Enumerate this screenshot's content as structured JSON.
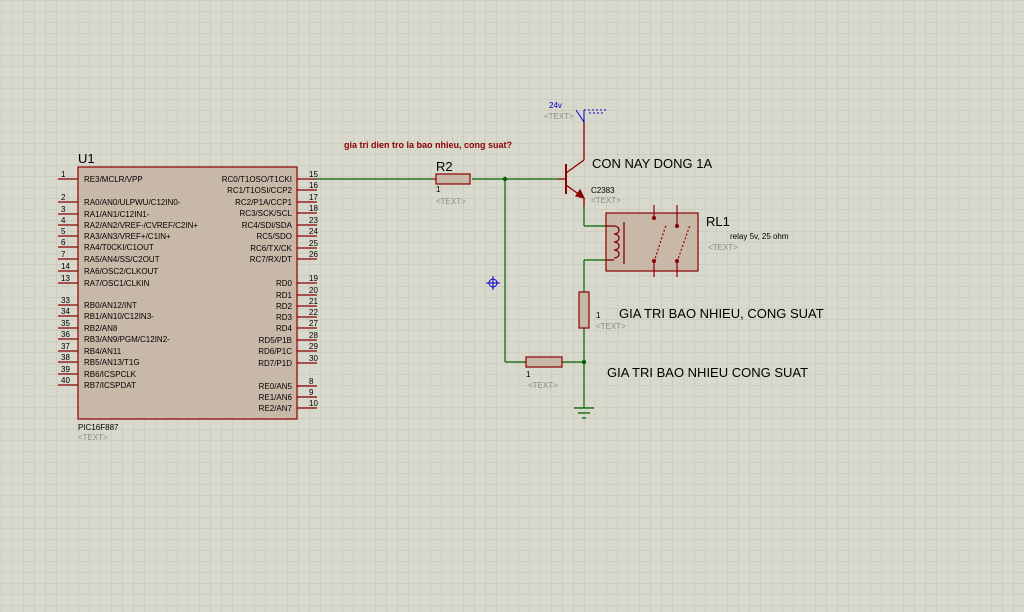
{
  "colors": {
    "background": "#d8d8cc",
    "grid": "#b8b8ac",
    "wire": "#006400",
    "component": "#8b0000",
    "chip_fill": "#c8b8a8",
    "text_placeholder": "#8a8a8a",
    "annotation": "#8b0000"
  },
  "u1": {
    "designator": "U1",
    "part": "PIC16F887",
    "text_placeholder": "<TEXT>",
    "left_pins": [
      {
        "num": "1",
        "name": "RE3/MCLR/VPP"
      },
      {
        "num": "2",
        "name": "RA0/AN0/ULPWU/C12IN0-"
      },
      {
        "num": "3",
        "name": "RA1/AN1/C12IN1-"
      },
      {
        "num": "4",
        "name": "RA2/AN2/VREF-/CVREF/C2IN+"
      },
      {
        "num": "5",
        "name": "RA3/AN3/VREF+/C1IN+"
      },
      {
        "num": "6",
        "name": "RA4/T0CKI/C1OUT"
      },
      {
        "num": "7",
        "name": "RA5/AN4/SS/C2OUT"
      },
      {
        "num": "14",
        "name": "RA6/OSC2/CLKOUT"
      },
      {
        "num": "13",
        "name": "RA7/OSC1/CLKIN"
      },
      {
        "num": "33",
        "name": "RB0/AN12/INT"
      },
      {
        "num": "34",
        "name": "RB1/AN10/C12IN3-"
      },
      {
        "num": "35",
        "name": "RB2/AN8"
      },
      {
        "num": "36",
        "name": "RB3/AN9/PGM/C12IN2-"
      },
      {
        "num": "37",
        "name": "RB4/AN11"
      },
      {
        "num": "38",
        "name": "RB5/AN13/T1G"
      },
      {
        "num": "39",
        "name": "RB6/ICSPCLK"
      },
      {
        "num": "40",
        "name": "RB7/ICSPDAT"
      }
    ],
    "right_pins": [
      {
        "num": "15",
        "name": "RC0/T1OSO/T1CKI"
      },
      {
        "num": "16",
        "name": "RC1/T1OSI/CCP2"
      },
      {
        "num": "17",
        "name": "RC2/P1A/CCP1"
      },
      {
        "num": "18",
        "name": "RC3/SCK/SCL"
      },
      {
        "num": "23",
        "name": "RC4/SDI/SDA"
      },
      {
        "num": "24",
        "name": "RC5/SDO"
      },
      {
        "num": "25",
        "name": "RC6/TX/CK"
      },
      {
        "num": "26",
        "name": "RC7/RX/DT"
      },
      {
        "num": "19",
        "name": "RD0"
      },
      {
        "num": "20",
        "name": "RD1"
      },
      {
        "num": "21",
        "name": "RD2"
      },
      {
        "num": "22",
        "name": "RD3"
      },
      {
        "num": "27",
        "name": "RD4"
      },
      {
        "num": "28",
        "name": "RD5/P1B"
      },
      {
        "num": "29",
        "name": "RD6/P1C"
      },
      {
        "num": "30",
        "name": "RD7/P1D"
      },
      {
        "num": "8",
        "name": "RE0/AN5"
      },
      {
        "num": "9",
        "name": "RE1/AN6"
      },
      {
        "num": "10",
        "name": "RE2/AN7"
      }
    ]
  },
  "r2": {
    "designator": "R2",
    "value": "1",
    "text_placeholder": "<TEXT>"
  },
  "transistor": {
    "part": "C2383",
    "text_placeholder": "<TEXT>"
  },
  "supply": {
    "label": "24v",
    "text_placeholder": "<TEXT>"
  },
  "relay": {
    "designator": "RL1",
    "value": "relay 5v, 25 ohm",
    "text_placeholder": "<TEXT>"
  },
  "r_series": {
    "value": "1",
    "text_placeholder": "<TEXT>"
  },
  "r_bottom": {
    "value": "1",
    "text_placeholder": "<TEXT>"
  },
  "annotations": {
    "question_top": "gia tri dien tro la bao nhieu, cong suat?",
    "transistor_note": "CON NAY DONG 1A",
    "resistor_note_1": "GIA TRI BAO NHIEU, CONG SUAT",
    "resistor_note_2": "GIA TRI BAO NHIEU CONG SUAT"
  }
}
